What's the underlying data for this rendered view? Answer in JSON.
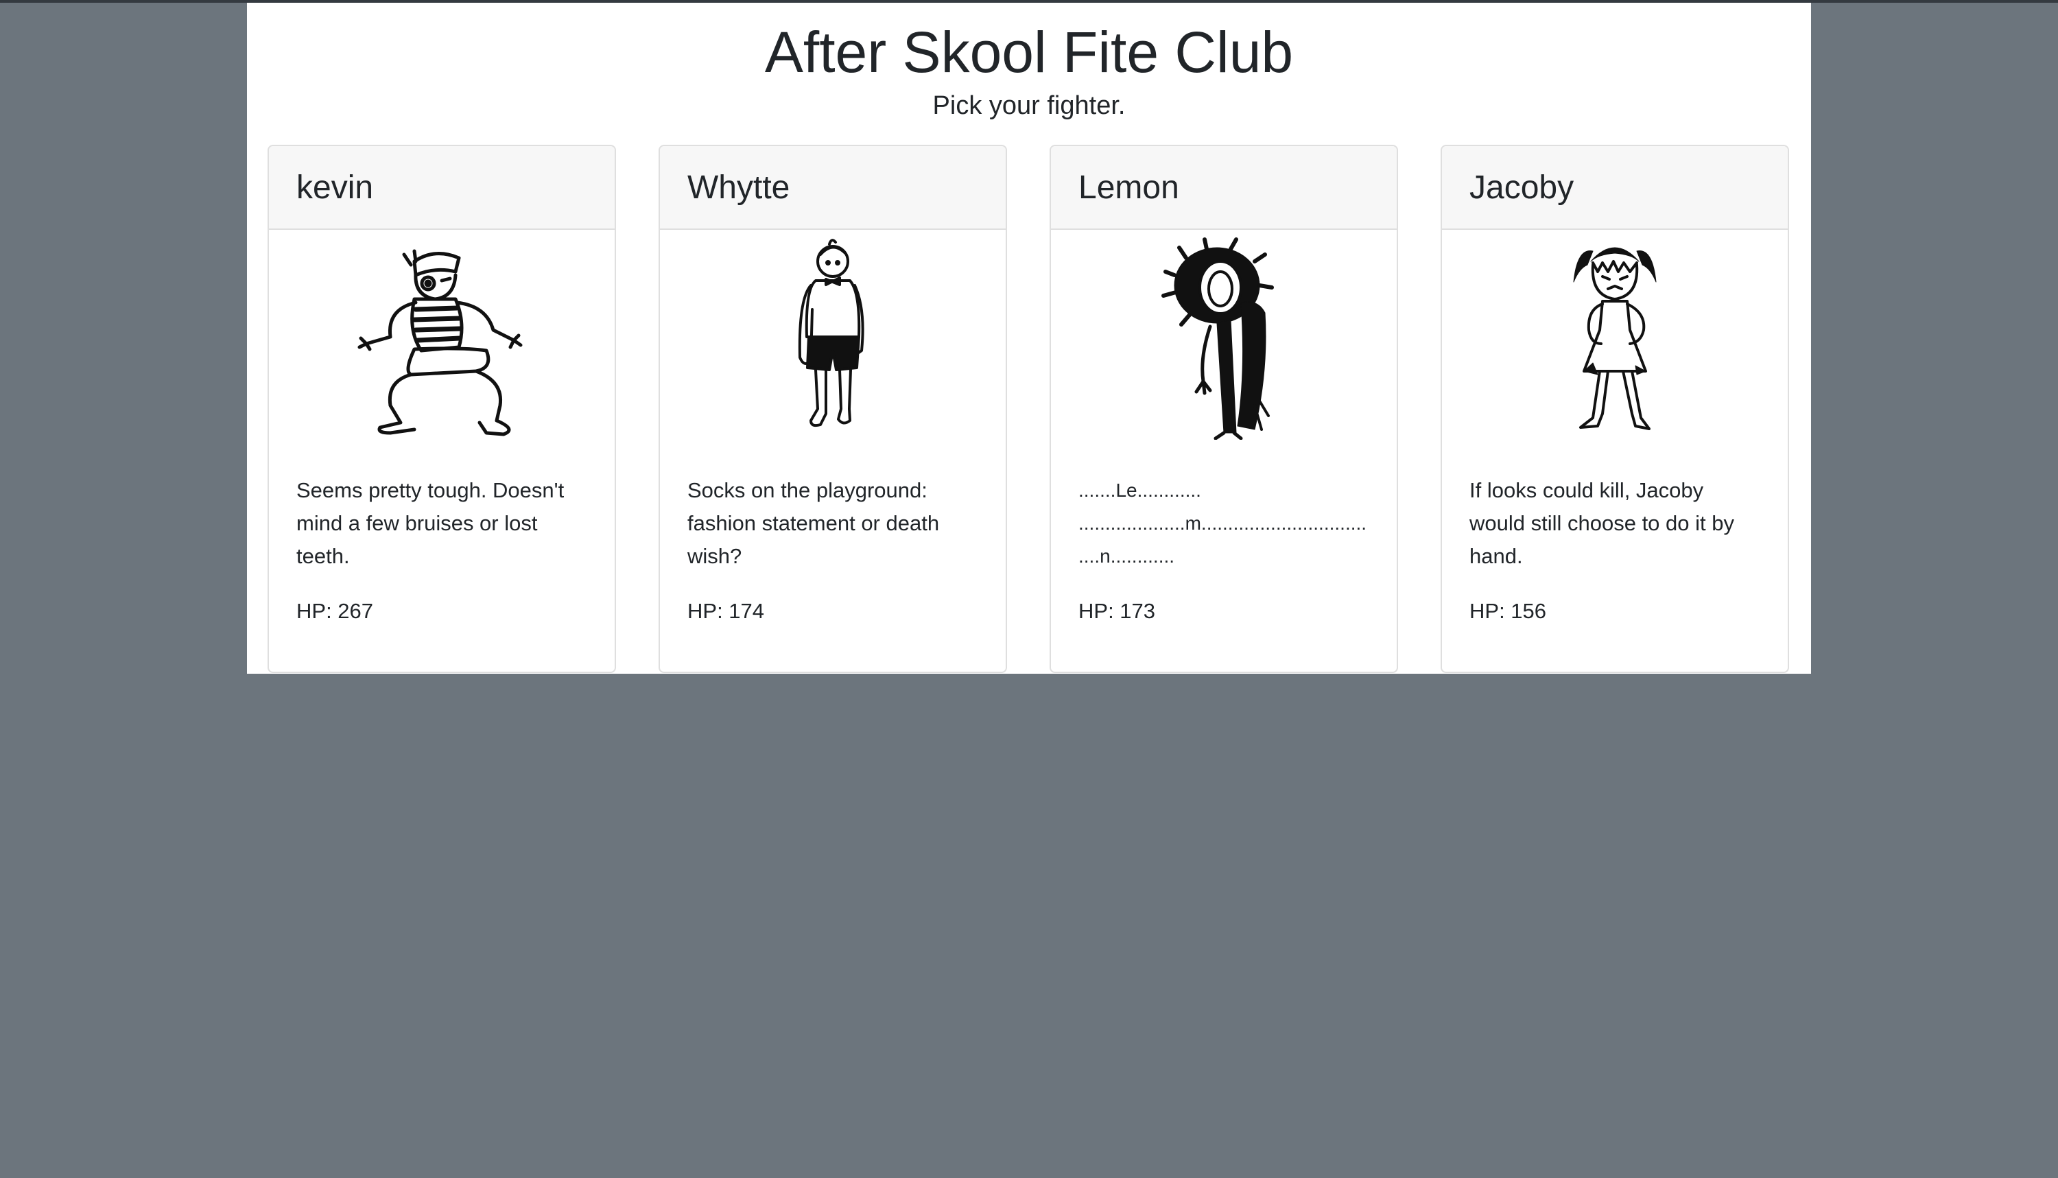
{
  "page": {
    "title": "After Skool Fite Club",
    "subtitle": "Pick your fighter."
  },
  "fighters": [
    {
      "name": "kevin",
      "icon": "kevin-portrait-icon",
      "description": "Seems pretty tough. Doesn't mind a few bruises or lost teeth.",
      "hp_label": "HP: 267"
    },
    {
      "name": "Whytte",
      "icon": "whytte-portrait-icon",
      "description": "Socks on the playground: fashion statement or death wish?",
      "hp_label": "HP: 174"
    },
    {
      "name": "Lemon",
      "icon": "lemon-portrait-icon",
      "description": ".......Le............ ....................m...................................n............",
      "hp_label": "HP: 173"
    },
    {
      "name": "Jacoby",
      "icon": "jacoby-portrait-icon",
      "description": "If looks could kill, Jacoby would still choose to do it by hand.",
      "hp_label": "HP: 156"
    }
  ],
  "colors": {
    "background": "#6c757d",
    "panel": "#ffffff",
    "card_header": "#f7f7f7",
    "border": "#dfdfdf"
  }
}
